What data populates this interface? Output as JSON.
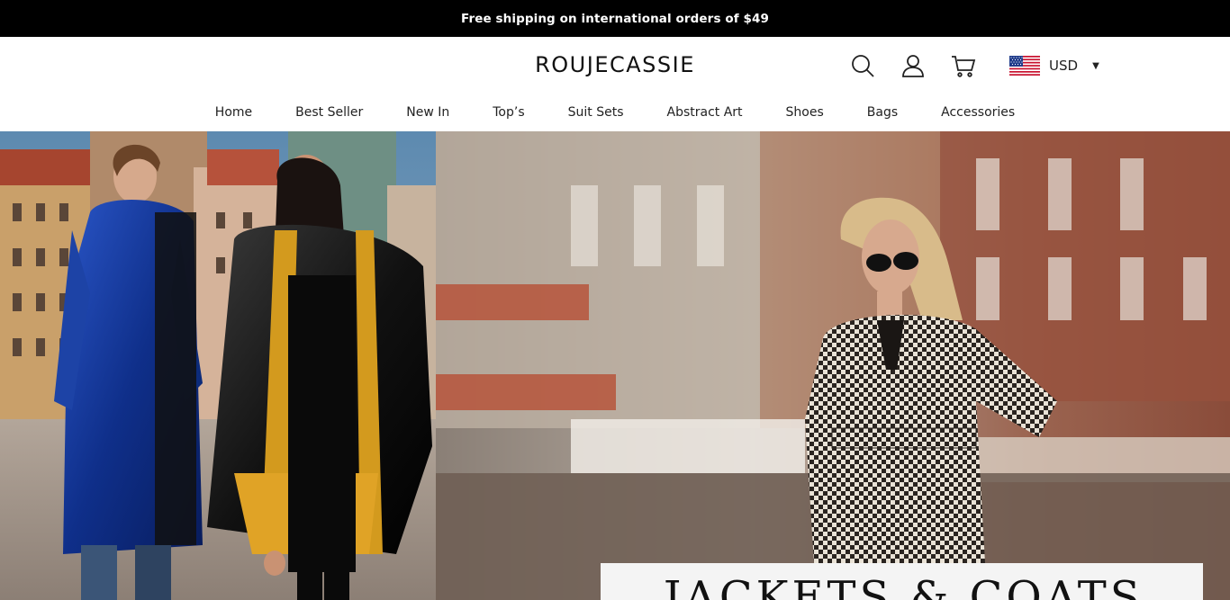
{
  "announcement": {
    "text": "Free shipping on international orders of $49"
  },
  "header": {
    "logo": "ROUJECASSIE",
    "icons": [
      "search-icon",
      "account-icon",
      "cart-icon"
    ],
    "currency": {
      "code": "USD",
      "flag": "us-flag-icon"
    }
  },
  "nav": {
    "items": [
      {
        "label": "Home"
      },
      {
        "label": "Best Seller"
      },
      {
        "label": "New In"
      },
      {
        "label": "Top’s"
      },
      {
        "label": "Suit Sets"
      },
      {
        "label": "Abstract Art"
      },
      {
        "label": "Shoes"
      },
      {
        "label": "Bags"
      },
      {
        "label": "Accessories"
      }
    ]
  },
  "hero": {
    "banner_title": "JACKETS & COATS"
  },
  "colors": {
    "announcement_bg": "#000000",
    "announcement_text": "#ffffff",
    "text": "#111111"
  }
}
